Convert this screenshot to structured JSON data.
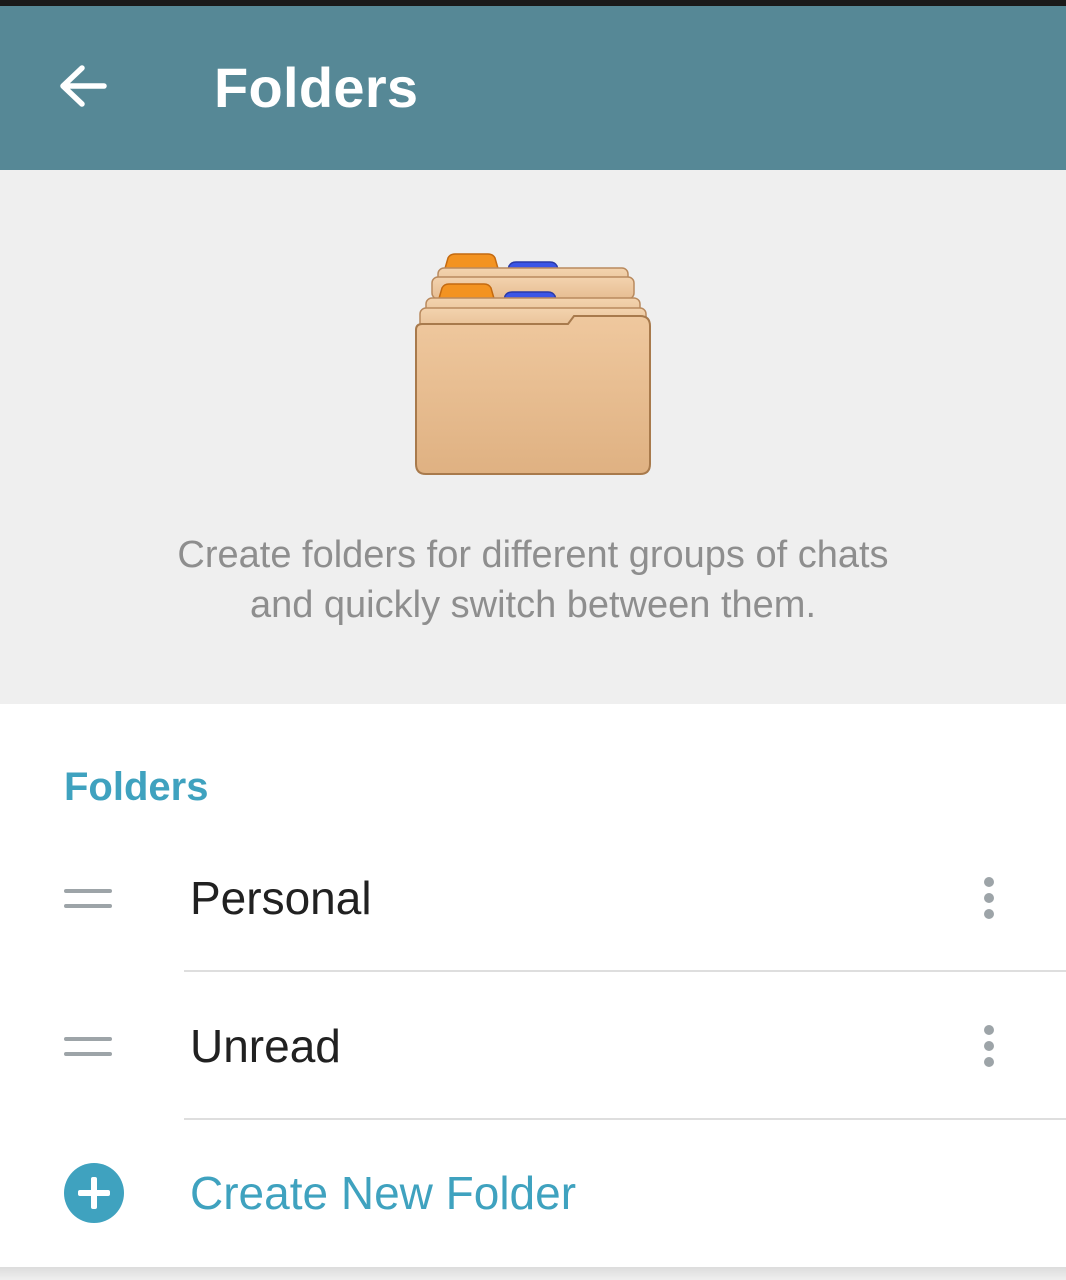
{
  "app_bar": {
    "title": "Folders",
    "back_icon": "arrow-left-icon",
    "background_color": "#568896"
  },
  "header": {
    "illustration": "card-file-folders-illustration",
    "description_line1": "Create folders for different groups of chats",
    "description_line2": "and quickly switch between them."
  },
  "folders_section": {
    "title": "Folders",
    "accent_color": "#3fa2bf",
    "items": [
      {
        "name": "Personal",
        "handle_icon": "drag-handle-icon",
        "menu_icon": "more-vertical-icon"
      },
      {
        "name": "Unread",
        "handle_icon": "drag-handle-icon",
        "menu_icon": "more-vertical-icon"
      }
    ],
    "create_button": {
      "label": "Create New Folder",
      "icon": "plus-circle-icon"
    }
  }
}
